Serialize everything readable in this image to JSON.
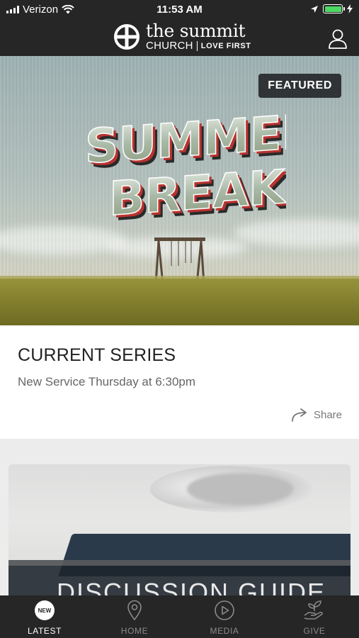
{
  "status_bar": {
    "carrier": "Verizon",
    "time": "11:53 AM",
    "battery_percent": 100
  },
  "header": {
    "brand_line1": "the summit",
    "brand_church": "CHURCH",
    "brand_tagline": "LOVE FIRST"
  },
  "hero": {
    "badge": "FEATURED",
    "title_line1": "SUMMER",
    "title_line2": "BREAK"
  },
  "series_card": {
    "title": "CURRENT SERIES",
    "subtitle": "New Service Thursday at 6:30pm",
    "share_label": "Share"
  },
  "discussion_card": {
    "title": "DISCUSSION GUIDE"
  },
  "tab_bar": {
    "items": [
      {
        "label": "LATEST",
        "badge": "NEW",
        "active": true
      },
      {
        "label": "HOME",
        "icon": "location-pin-icon"
      },
      {
        "label": "MEDIA",
        "icon": "play-circle-icon"
      },
      {
        "label": "GIVE",
        "icon": "hand-plant-icon"
      }
    ]
  },
  "colors": {
    "bar_bg": "#262626",
    "battery_green": "#4cd964",
    "active_tab": "#ffffff",
    "inactive_tab": "#8a8a8a"
  }
}
